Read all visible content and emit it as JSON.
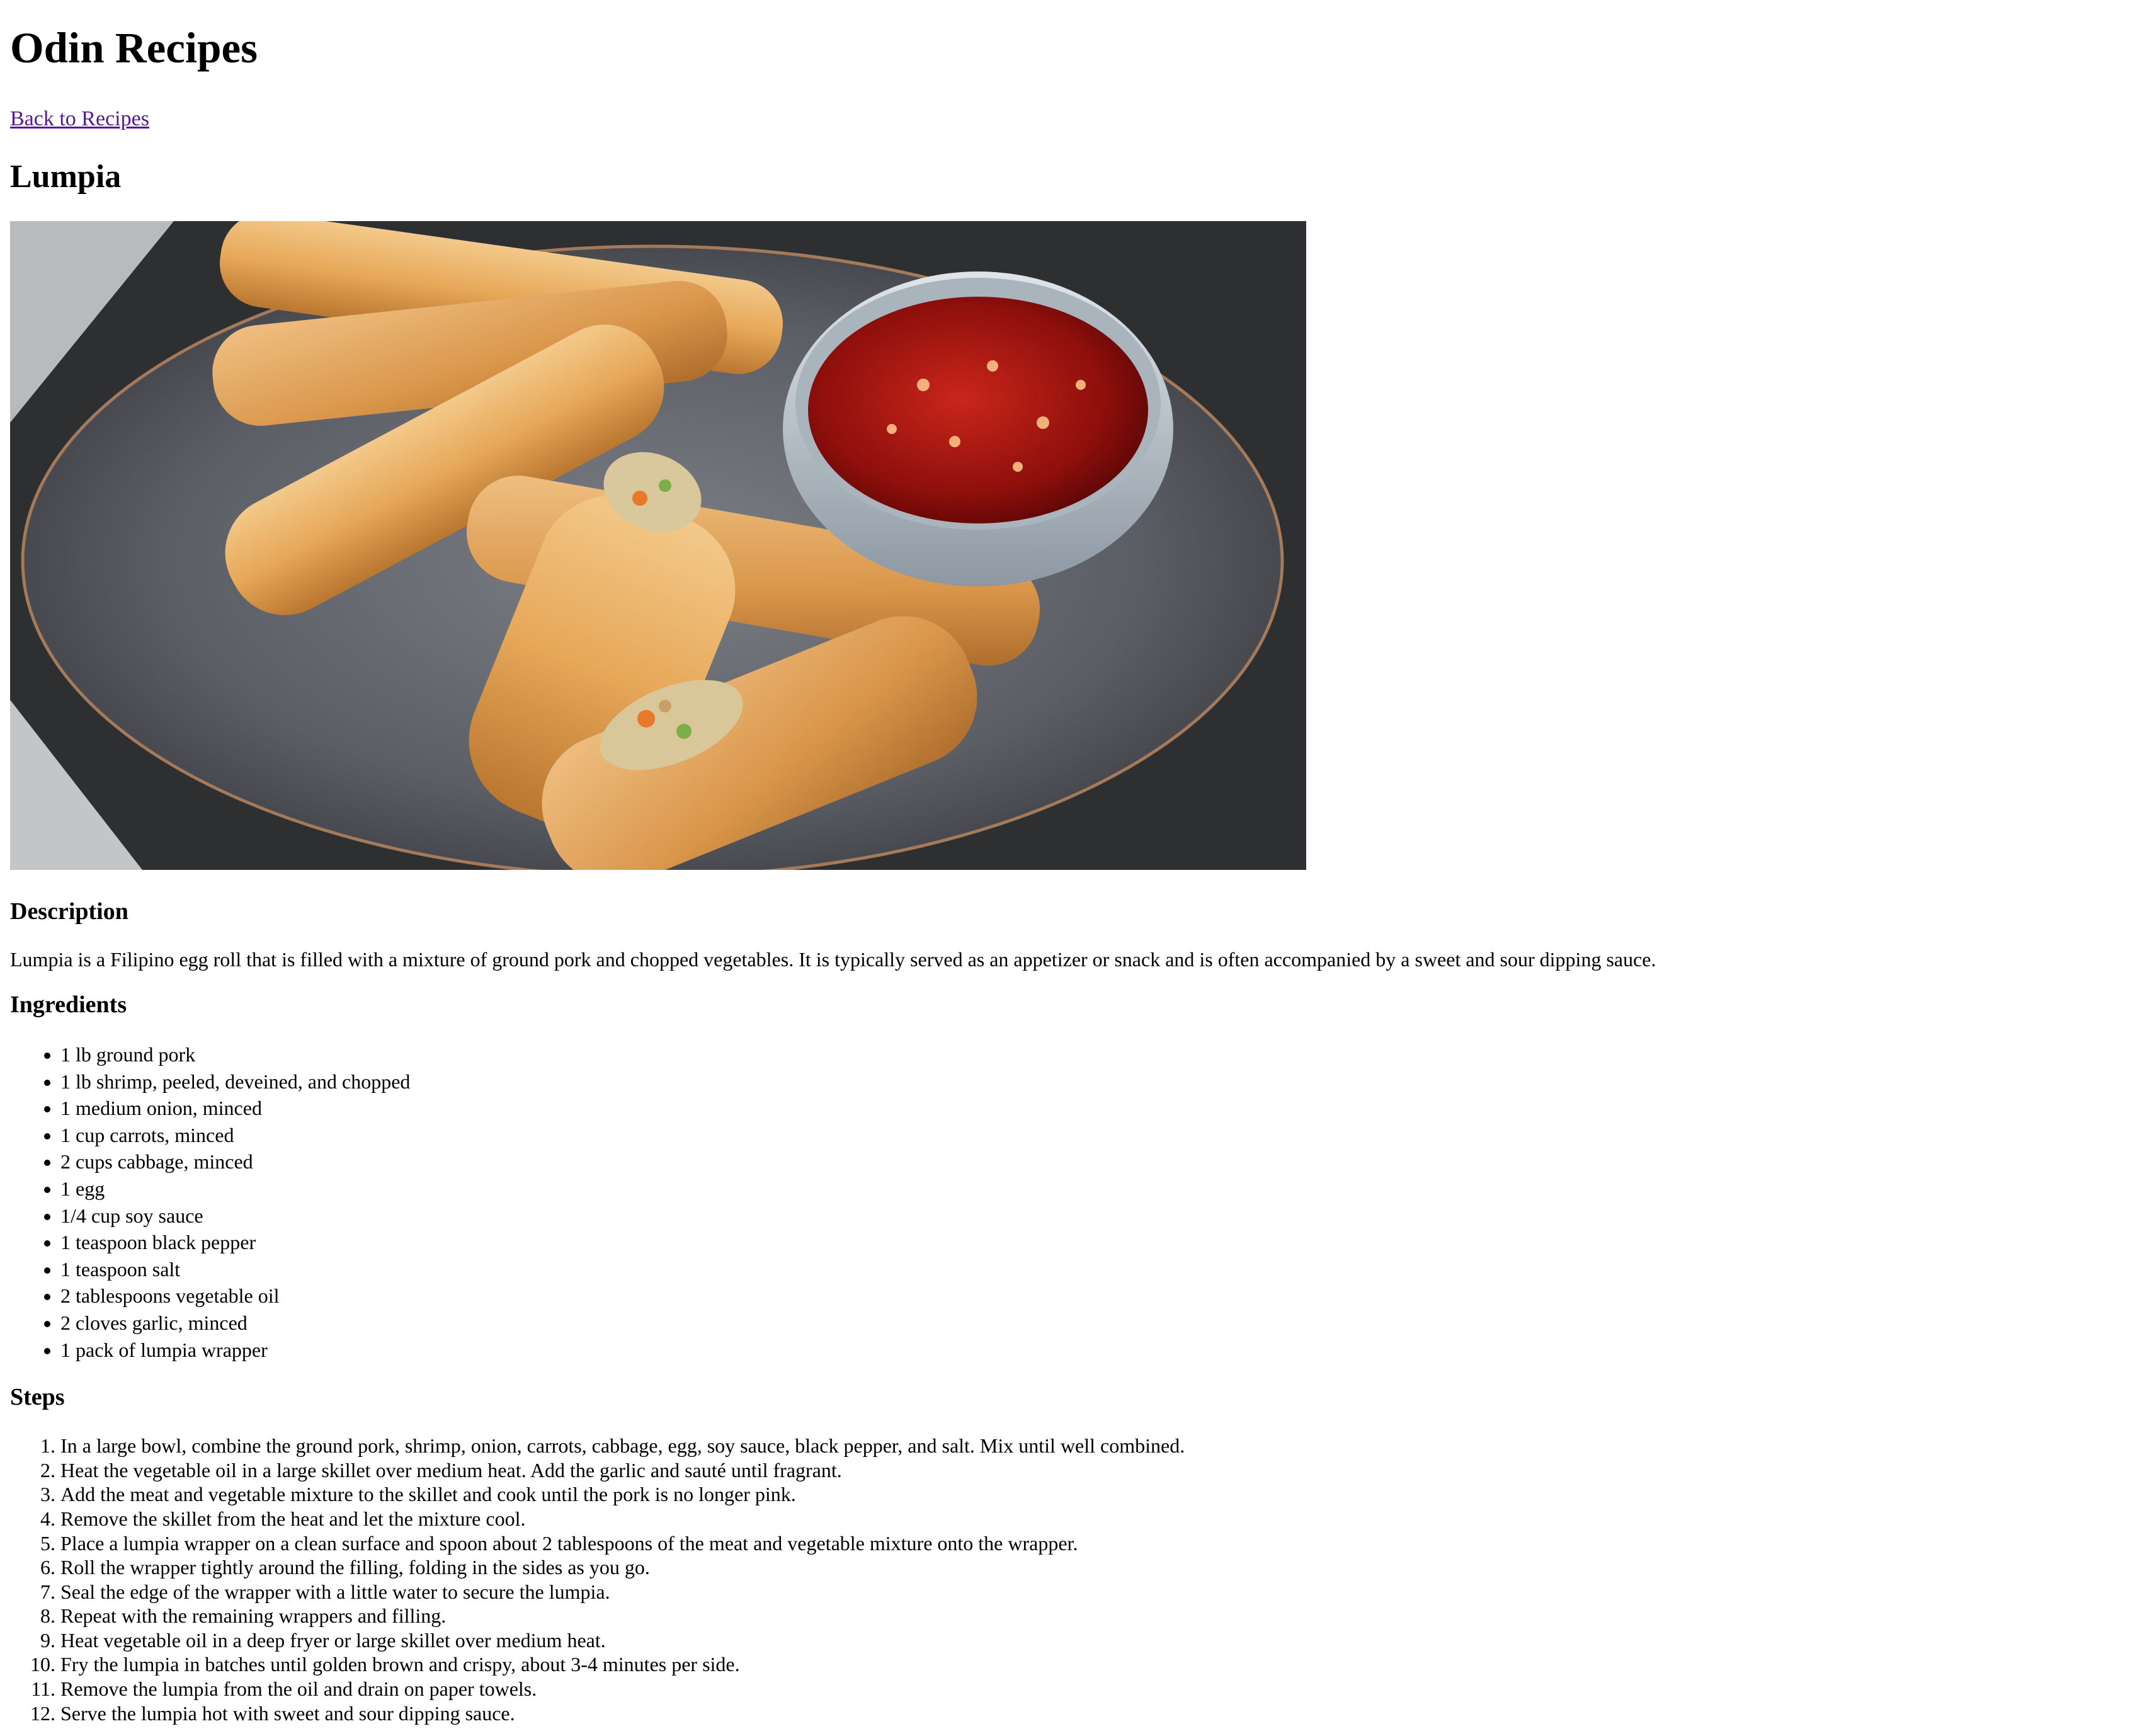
{
  "site": {
    "title": "Odin Recipes",
    "back_link": "Back to Recipes"
  },
  "recipe": {
    "title": "Lumpia",
    "image_alt": "Lumpia",
    "description_heading": "Description",
    "description": "Lumpia is a Filipino egg roll that is filled with a mixture of ground pork and chopped vegetables. It is typically served as an appetizer or snack and is often accompanied by a sweet and sour dipping sauce.",
    "ingredients_heading": "Ingredients",
    "ingredients": [
      "1 lb ground pork",
      "1 lb shrimp, peeled, deveined, and chopped",
      "1 medium onion, minced",
      "1 cup carrots, minced",
      "2 cups cabbage, minced",
      "1 egg",
      "1/4 cup soy sauce",
      "1 teaspoon black pepper",
      "1 teaspoon salt",
      "2 tablespoons vegetable oil",
      "2 cloves garlic, minced",
      "1 pack of lumpia wrapper"
    ],
    "steps_heading": "Steps",
    "steps": [
      "In a large bowl, combine the ground pork, shrimp, onion, carrots, cabbage, egg, soy sauce, black pepper, and salt. Mix until well combined.",
      "Heat the vegetable oil in a large skillet over medium heat. Add the garlic and sauté until fragrant.",
      "Add the meat and vegetable mixture to the skillet and cook until the pork is no longer pink.",
      "Remove the skillet from the heat and let the mixture cool.",
      "Place a lumpia wrapper on a clean surface and spoon about 2 tablespoons of the meat and vegetable mixture onto the wrapper.",
      "Roll the wrapper tightly around the filling, folding in the sides as you go.",
      "Seal the edge of the wrapper with a little water to secure the lumpia.",
      "Repeat with the remaining wrappers and filling.",
      "Heat vegetable oil in a deep fryer or large skillet over medium heat.",
      "Fry the lumpia in batches until golden brown and crispy, about 3-4 minutes per side.",
      "Remove the lumpia from the oil and drain on paper towels.",
      "Serve the lumpia hot with sweet and sour dipping sauce."
    ]
  },
  "colors": {
    "link_visited": "#551a8b",
    "text": "#000000",
    "background": "#ffffff"
  }
}
